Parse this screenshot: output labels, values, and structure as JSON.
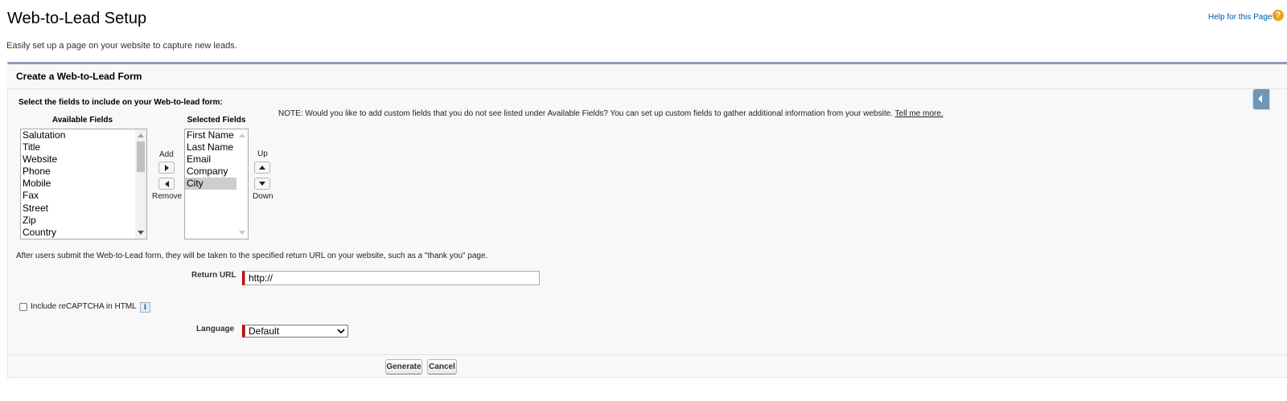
{
  "header": {
    "title": "Web-to-Lead Setup",
    "description": "Easily set up a page on your website to capture new leads.",
    "help_link": "Help for this Page",
    "help_icon": "?"
  },
  "panel": {
    "title": "Create a Web-to-Lead Form",
    "select_label": "Select the fields to include on your Web-to-lead form:",
    "available_label": "Available Fields",
    "selected_label": "Selected Fields",
    "available_fields": [
      "Salutation",
      "Title",
      "Website",
      "Phone",
      "Mobile",
      "Fax",
      "Street",
      "Zip",
      "Country"
    ],
    "selected_fields": [
      "First Name",
      "Last Name",
      "Email",
      "Company",
      "City"
    ],
    "selected_highlight": "City",
    "add_label": "Add",
    "remove_label": "Remove",
    "up_label": "Up",
    "down_label": "Down",
    "note_text": "NOTE: Would you like to add custom fields that you do not see listed under Available Fields? You can set up custom fields to gather additional information from your website. ",
    "note_link": "Tell me more.",
    "after_text": "After users submit the Web-to-Lead form, they will be taken to the specified return URL on your website, such as a \"thank you\" page.",
    "return_url_label": "Return URL",
    "return_url_value": "http://",
    "recaptcha_label": "Include reCAPTCHA in HTML",
    "recaptcha_checked": false,
    "info_icon": "i",
    "language_label": "Language",
    "language_value": "Default"
  },
  "buttons": {
    "generate": "Generate",
    "cancel": "Cancel"
  },
  "colors": {
    "required": "#cc0000",
    "help_link": "#015ba7",
    "panel_border": "#8e9dbe"
  }
}
